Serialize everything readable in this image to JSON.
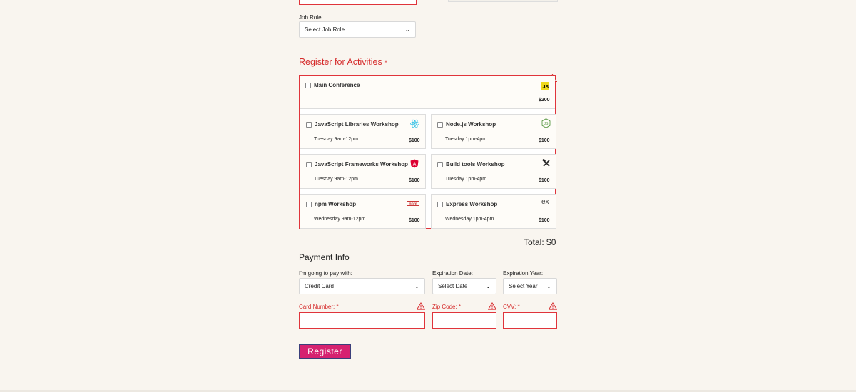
{
  "job_role": {
    "label": "Job Role",
    "select_value": "Select Job Role"
  },
  "activities": {
    "title": "Register for Activities",
    "required_marker": "*",
    "main": {
      "name": "Main Conference",
      "price": "$200",
      "icon": "js-icon"
    },
    "items": [
      {
        "name": "JavaScript Libraries Workshop",
        "time": "Tuesday 9am-12pm",
        "price": "$100",
        "icon": "react-icon"
      },
      {
        "name": "Node.js Workshop",
        "time": "Tuesday 1pm-4pm",
        "price": "$100",
        "icon": "nodejs-icon"
      },
      {
        "name": "JavaScript Frameworks Workshop",
        "time": "Tuesday 9am-12pm",
        "price": "$100",
        "icon": "angular-icon"
      },
      {
        "name": "Build tools Workshop",
        "time": "Tuesday 1pm-4pm",
        "price": "$100",
        "icon": "tools-icon"
      },
      {
        "name": "npm Workshop",
        "time": "Wednesday 9am-12pm",
        "price": "$100",
        "icon": "npm-icon"
      },
      {
        "name": "Express Workshop",
        "time": "Wednesday 1pm-4pm",
        "price": "$100",
        "icon": "express-icon"
      }
    ],
    "total": "Total: $0"
  },
  "payment": {
    "title": "Payment Info",
    "method_label": "I'm going to pay with:",
    "method_value": "Credit Card",
    "exp_date_label": "Expiration Date:",
    "exp_date_value": "Select Date",
    "exp_year_label": "Expiration Year:",
    "exp_year_value": "Select Year",
    "card_number_label": "Card Number: *",
    "zip_label": "Zip Code: *",
    "cvv_label": "CVV: *",
    "card_number_value": "",
    "zip_value": "",
    "cvv_value": ""
  },
  "register_label": "Register",
  "colors": {
    "error": "#d52b2b",
    "button": "#d62270",
    "background": "#f9f5ef"
  }
}
